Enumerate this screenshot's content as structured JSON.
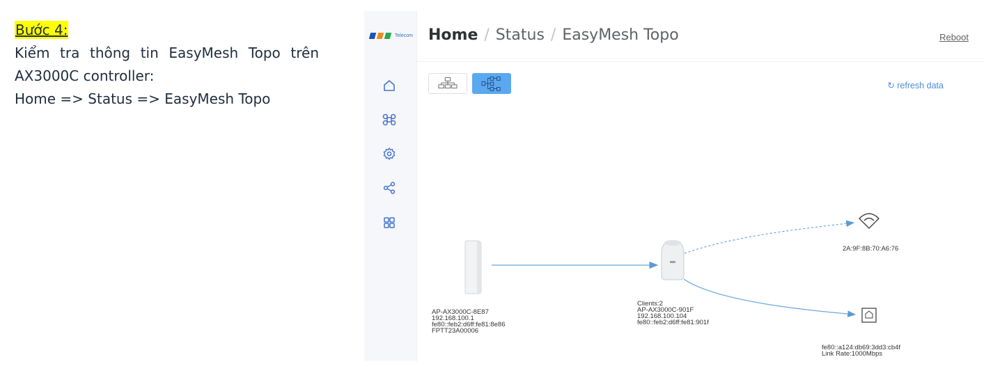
{
  "instructions": {
    "step_label": "Bước 4:",
    "line1": "Kiểm tra thông tin EasyMesh Topo trên",
    "line2": "AX3000C controller:",
    "line3": "Home => Status => EasyMesh Topo"
  },
  "app": {
    "logo_text": "Telecom",
    "brand_colors": [
      "#1a56b4",
      "#f08a24",
      "#2aa84a"
    ],
    "nav_icons": [
      "home-icon",
      "command-icon",
      "gear-icon",
      "share-icon",
      "grid-icon"
    ]
  },
  "header": {
    "breadcrumb_home": "Home",
    "breadcrumb_status": "Status",
    "breadcrumb_page": "EasyMesh Topo",
    "separator": "/",
    "reboot": "Reboot"
  },
  "toolbar": {
    "refresh": "refresh data",
    "active_view": "horizontal-tree"
  },
  "topology": {
    "controller": {
      "name": "AP-AX3000C-8E87",
      "ip": "192.168.100.1",
      "ipv6": "fe80::feb2:d6ff:fe81:8e86",
      "serial": "FPTT23A00006"
    },
    "agent": {
      "clients": "Clients:2",
      "name": "AP-AX3000C-901F",
      "ip": "192.168.100.104",
      "ipv6": "fe80::feb2:d6ff:fe81:901f"
    },
    "wifi_client": {
      "mac": "2A:9F:8B:70:A6:76"
    },
    "wired_client": {
      "ipv6": "fe80::a124:db69:3dd3:cb4f",
      "link_rate": "Link Rate:1000Mbps"
    }
  }
}
